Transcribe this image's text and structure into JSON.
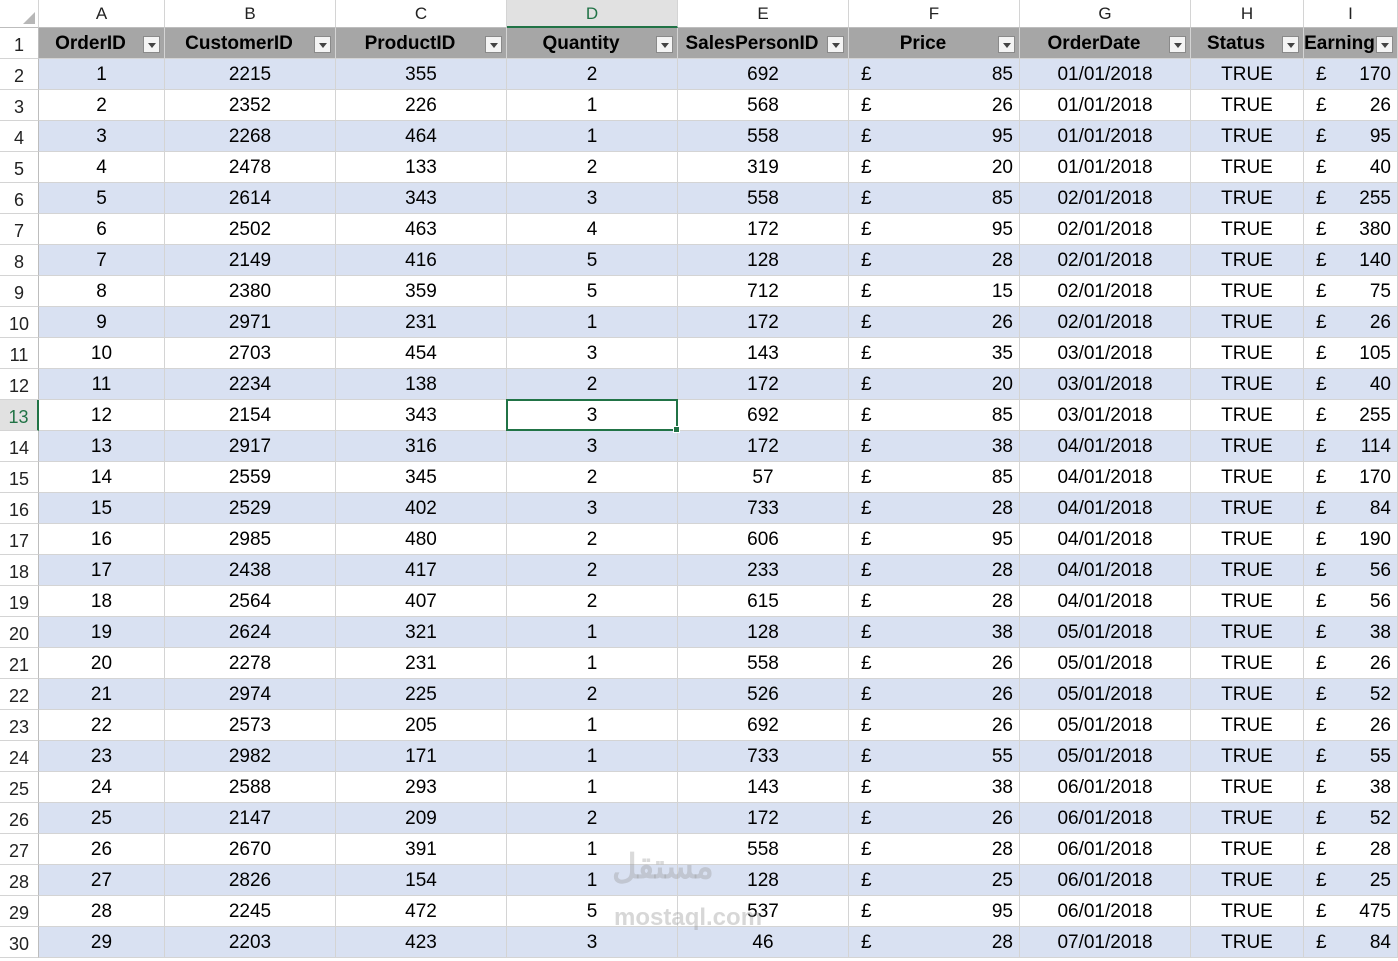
{
  "columns": [
    "A",
    "B",
    "C",
    "D",
    "E",
    "F",
    "G",
    "H",
    "I"
  ],
  "active_column": "D",
  "active_row": 13,
  "headers": [
    "OrderID",
    "CustomerID",
    "ProductID",
    "Quantity",
    "SalesPersonID",
    "Price",
    "OrderDate",
    "Status",
    "Earning"
  ],
  "currency_symbol": "£",
  "watermark": {
    "arabic": "مستقل",
    "latin": "mostaql.com"
  },
  "colors": {
    "header_fill": "#a6a6a6",
    "band_fill": "#d9e1f2",
    "selection": "#217346"
  },
  "rows": [
    {
      "n": 2,
      "cells": [
        "1",
        "2215",
        "355",
        "2",
        "692",
        "85",
        "01/01/2018",
        "TRUE",
        "170"
      ]
    },
    {
      "n": 3,
      "cells": [
        "2",
        "2352",
        "226",
        "1",
        "568",
        "26",
        "01/01/2018",
        "TRUE",
        "26"
      ]
    },
    {
      "n": 4,
      "cells": [
        "3",
        "2268",
        "464",
        "1",
        "558",
        "95",
        "01/01/2018",
        "TRUE",
        "95"
      ]
    },
    {
      "n": 5,
      "cells": [
        "4",
        "2478",
        "133",
        "2",
        "319",
        "20",
        "01/01/2018",
        "TRUE",
        "40"
      ]
    },
    {
      "n": 6,
      "cells": [
        "5",
        "2614",
        "343",
        "3",
        "558",
        "85",
        "02/01/2018",
        "TRUE",
        "255"
      ]
    },
    {
      "n": 7,
      "cells": [
        "6",
        "2502",
        "463",
        "4",
        "172",
        "95",
        "02/01/2018",
        "TRUE",
        "380"
      ]
    },
    {
      "n": 8,
      "cells": [
        "7",
        "2149",
        "416",
        "5",
        "128",
        "28",
        "02/01/2018",
        "TRUE",
        "140"
      ]
    },
    {
      "n": 9,
      "cells": [
        "8",
        "2380",
        "359",
        "5",
        "712",
        "15",
        "02/01/2018",
        "TRUE",
        "75"
      ]
    },
    {
      "n": 10,
      "cells": [
        "9",
        "2971",
        "231",
        "1",
        "172",
        "26",
        "02/01/2018",
        "TRUE",
        "26"
      ]
    },
    {
      "n": 11,
      "cells": [
        "10",
        "2703",
        "454",
        "3",
        "143",
        "35",
        "03/01/2018",
        "TRUE",
        "105"
      ]
    },
    {
      "n": 12,
      "cells": [
        "11",
        "2234",
        "138",
        "2",
        "172",
        "20",
        "03/01/2018",
        "TRUE",
        "40"
      ]
    },
    {
      "n": 13,
      "cells": [
        "12",
        "2154",
        "343",
        "3",
        "692",
        "85",
        "03/01/2018",
        "TRUE",
        "255"
      ]
    },
    {
      "n": 14,
      "cells": [
        "13",
        "2917",
        "316",
        "3",
        "172",
        "38",
        "04/01/2018",
        "TRUE",
        "114"
      ]
    },
    {
      "n": 15,
      "cells": [
        "14",
        "2559",
        "345",
        "2",
        "57",
        "85",
        "04/01/2018",
        "TRUE",
        "170"
      ]
    },
    {
      "n": 16,
      "cells": [
        "15",
        "2529",
        "402",
        "3",
        "733",
        "28",
        "04/01/2018",
        "TRUE",
        "84"
      ]
    },
    {
      "n": 17,
      "cells": [
        "16",
        "2985",
        "480",
        "2",
        "606",
        "95",
        "04/01/2018",
        "TRUE",
        "190"
      ]
    },
    {
      "n": 18,
      "cells": [
        "17",
        "2438",
        "417",
        "2",
        "233",
        "28",
        "04/01/2018",
        "TRUE",
        "56"
      ]
    },
    {
      "n": 19,
      "cells": [
        "18",
        "2564",
        "407",
        "2",
        "615",
        "28",
        "04/01/2018",
        "TRUE",
        "56"
      ]
    },
    {
      "n": 20,
      "cells": [
        "19",
        "2624",
        "321",
        "1",
        "128",
        "38",
        "05/01/2018",
        "TRUE",
        "38"
      ]
    },
    {
      "n": 21,
      "cells": [
        "20",
        "2278",
        "231",
        "1",
        "558",
        "26",
        "05/01/2018",
        "TRUE",
        "26"
      ]
    },
    {
      "n": 22,
      "cells": [
        "21",
        "2974",
        "225",
        "2",
        "526",
        "26",
        "05/01/2018",
        "TRUE",
        "52"
      ]
    },
    {
      "n": 23,
      "cells": [
        "22",
        "2573",
        "205",
        "1",
        "692",
        "26",
        "05/01/2018",
        "TRUE",
        "26"
      ]
    },
    {
      "n": 24,
      "cells": [
        "23",
        "2982",
        "171",
        "1",
        "733",
        "55",
        "05/01/2018",
        "TRUE",
        "55"
      ]
    },
    {
      "n": 25,
      "cells": [
        "24",
        "2588",
        "293",
        "1",
        "143",
        "38",
        "06/01/2018",
        "TRUE",
        "38"
      ]
    },
    {
      "n": 26,
      "cells": [
        "25",
        "2147",
        "209",
        "2",
        "172",
        "26",
        "06/01/2018",
        "TRUE",
        "52"
      ]
    },
    {
      "n": 27,
      "cells": [
        "26",
        "2670",
        "391",
        "1",
        "558",
        "28",
        "06/01/2018",
        "TRUE",
        "28"
      ]
    },
    {
      "n": 28,
      "cells": [
        "27",
        "2826",
        "154",
        "1",
        "128",
        "25",
        "06/01/2018",
        "TRUE",
        "25"
      ]
    },
    {
      "n": 29,
      "cells": [
        "28",
        "2245",
        "472",
        "5",
        "537",
        "95",
        "06/01/2018",
        "TRUE",
        "475"
      ]
    },
    {
      "n": 30,
      "cells": [
        "29",
        "2203",
        "423",
        "3",
        "46",
        "28",
        "07/01/2018",
        "TRUE",
        "84"
      ]
    }
  ]
}
